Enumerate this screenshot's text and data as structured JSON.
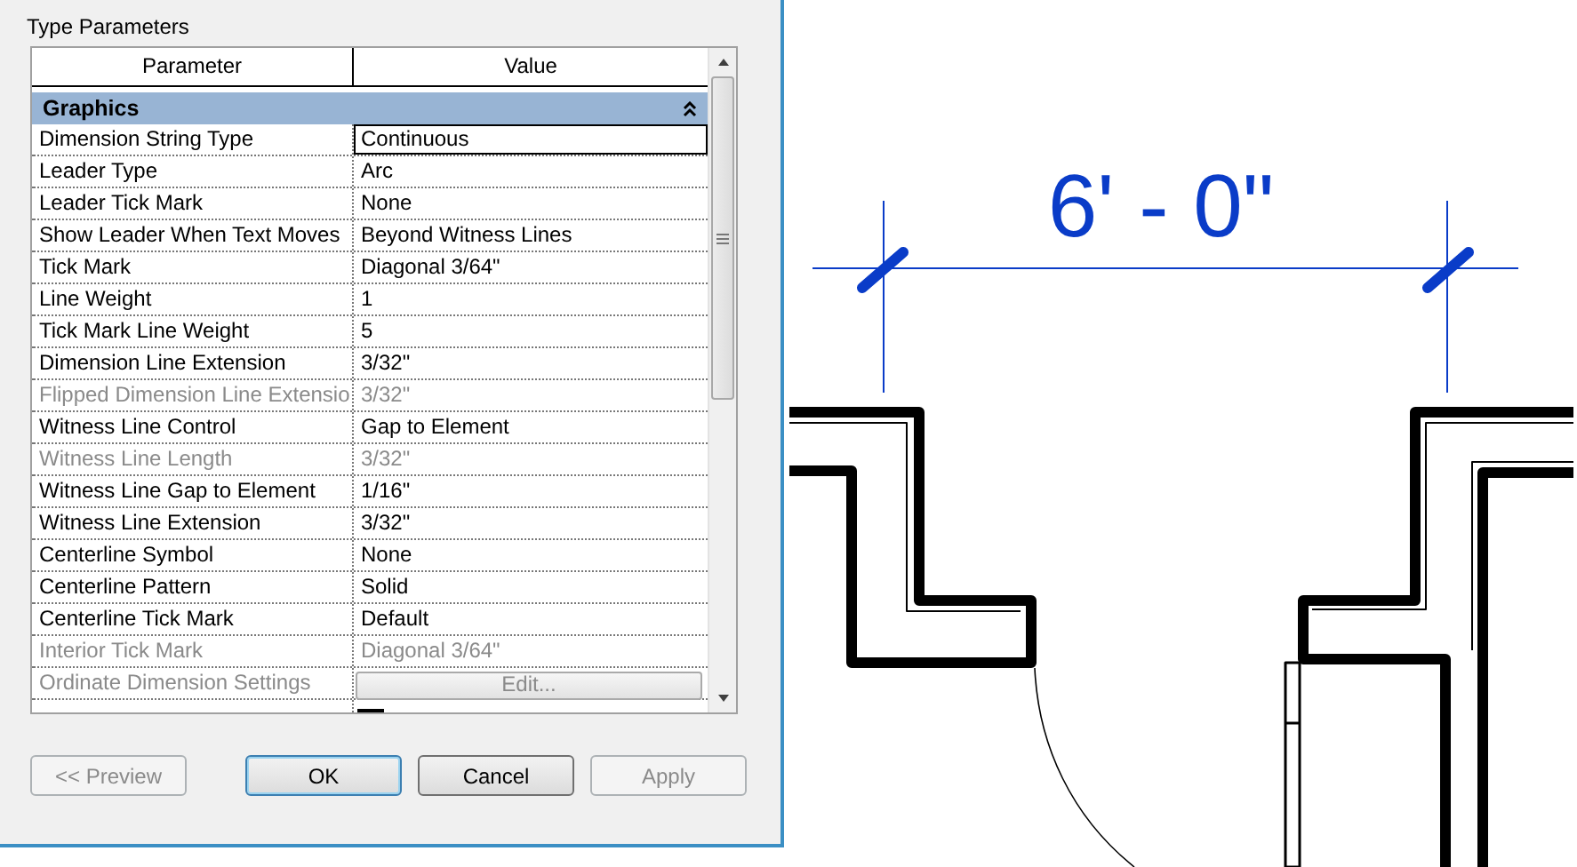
{
  "dialog": {
    "section_title": "Type Parameters",
    "columns": [
      "Parameter",
      "Value"
    ],
    "group": {
      "label": "Graphics",
      "expanded": true
    },
    "rows": [
      {
        "name": "Dimension String Type",
        "value": "Continuous",
        "disabled": false,
        "selected": true
      },
      {
        "name": "Leader Type",
        "value": "Arc",
        "disabled": false,
        "selected": false
      },
      {
        "name": "Leader Tick Mark",
        "value": "None",
        "disabled": false,
        "selected": false
      },
      {
        "name": "Show Leader When Text Moves",
        "value": "Beyond Witness Lines",
        "disabled": false,
        "selected": false
      },
      {
        "name": "Tick Mark",
        "value": "Diagonal 3/64\"",
        "disabled": false,
        "selected": false
      },
      {
        "name": "Line Weight",
        "value": "1",
        "disabled": false,
        "selected": false
      },
      {
        "name": "Tick Mark Line Weight",
        "value": "5",
        "disabled": false,
        "selected": false
      },
      {
        "name": "Dimension Line Extension",
        "value": "3/32\"",
        "disabled": false,
        "selected": false
      },
      {
        "name": "Flipped Dimension Line Extensio",
        "value": "3/32\"",
        "disabled": true,
        "selected": false
      },
      {
        "name": "Witness Line Control",
        "value": "Gap to Element",
        "disabled": false,
        "selected": false
      },
      {
        "name": "Witness Line Length",
        "value": "3/32\"",
        "disabled": true,
        "selected": false
      },
      {
        "name": "Witness Line Gap to Element",
        "value": "1/16\"",
        "disabled": false,
        "selected": false
      },
      {
        "name": "Witness Line Extension",
        "value": "3/32\"",
        "disabled": false,
        "selected": false
      },
      {
        "name": "Centerline Symbol",
        "value": "None",
        "disabled": false,
        "selected": false
      },
      {
        "name": "Centerline Pattern",
        "value": "Solid",
        "disabled": false,
        "selected": false
      },
      {
        "name": "Centerline Tick Mark",
        "value": "Default",
        "disabled": false,
        "selected": false
      },
      {
        "name": "Interior Tick Mark",
        "value": "Diagonal 3/64\"",
        "disabled": true,
        "selected": false
      },
      {
        "name": "Ordinate Dimension Settings",
        "value": "Edit...",
        "kind": "button",
        "disabled": true
      },
      {
        "kind": "swatch",
        "color": "#000000"
      }
    ],
    "buttons": [
      {
        "label": "<< Preview",
        "disabled": true,
        "default": false
      },
      {
        "label": "OK",
        "disabled": false,
        "default": true
      },
      {
        "label": "Cancel",
        "disabled": false,
        "default": false
      },
      {
        "label": "Apply",
        "disabled": true,
        "default": false
      }
    ]
  },
  "drawing": {
    "dimension_label": "6' - 0\""
  }
}
